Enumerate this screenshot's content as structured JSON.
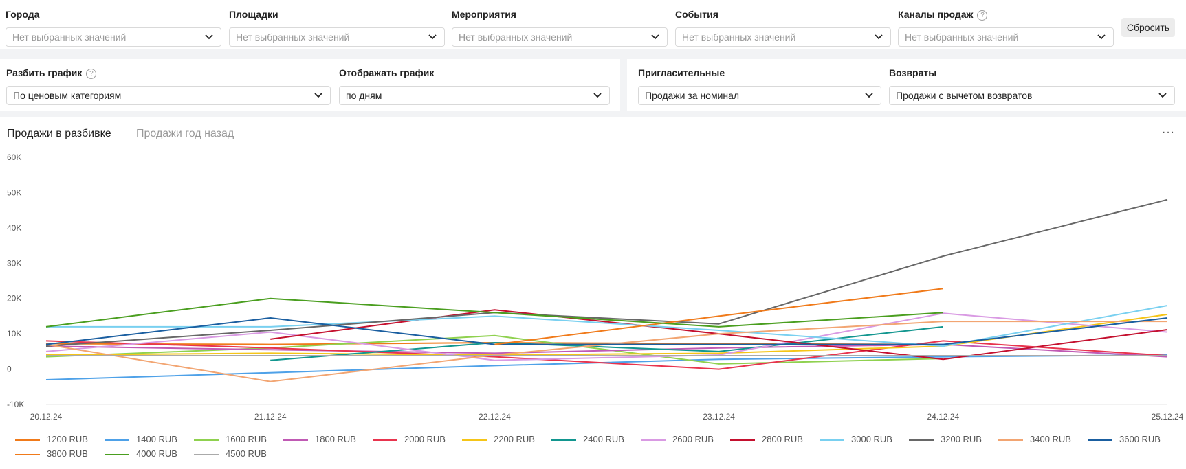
{
  "filters": {
    "cities": {
      "label": "Города",
      "placeholder": "Нет выбранных значений"
    },
    "venues": {
      "label": "Площадки",
      "placeholder": "Нет выбранных значений"
    },
    "events_group": {
      "label": "Мероприятия",
      "placeholder": "Нет выбранных значений"
    },
    "events": {
      "label": "События",
      "placeholder": "Нет выбранных значений"
    },
    "channels": {
      "label": "Каналы продаж",
      "placeholder": "Нет выбранных значений"
    },
    "reset_label": "Сбросить"
  },
  "options": {
    "split": {
      "label": "Разбить график",
      "value": "По ценовым категориям"
    },
    "display": {
      "label": "Отображать график",
      "value": "по дням"
    },
    "invitations": {
      "label": "Пригласительные",
      "value": "Продажи за номинал"
    },
    "returns": {
      "label": "Возвраты",
      "value": "Продажи с вычетом возвратов"
    }
  },
  "tabs": {
    "active": "Продажи в разбивке",
    "inactive": "Продажи год назад",
    "more": "···"
  },
  "icons": {
    "help": "question-circle-icon",
    "chevron": "chevron-down-icon",
    "more": "more-horizontal-icon"
  },
  "chart_data": {
    "type": "line",
    "x": [
      "20.12.24",
      "21.12.24",
      "22.12.24",
      "23.12.24",
      "24.12.24",
      "25.12.24"
    ],
    "y_ticks": [
      "60K",
      "50K",
      "40K",
      "30K",
      "20K",
      "10K",
      "0",
      "-10K"
    ],
    "ylim": [
      -10000,
      60000
    ],
    "grid": false,
    "legend_position": "bottom",
    "series": [
      {
        "name": "1200 RUB",
        "color": "#f07a1a",
        "values": [
          7200,
          7000,
          7500,
          7200,
          7000,
          null
        ]
      },
      {
        "name": "1400 RUB",
        "color": "#4ea1e8",
        "values": [
          -3000,
          -1000,
          1000,
          2800,
          3500,
          4000
        ]
      },
      {
        "name": "1600 RUB",
        "color": "#8fd14f",
        "values": [
          3500,
          6000,
          9500,
          1500,
          3000,
          null
        ]
      },
      {
        "name": "1800 RUB",
        "color": "#c05ab4",
        "values": [
          6500,
          5500,
          4500,
          6000,
          7000,
          3500
        ]
      },
      {
        "name": "2000 RUB",
        "color": "#e8344e",
        "values": [
          8000,
          6000,
          3500,
          0,
          8000,
          3800
        ]
      },
      {
        "name": "2200 RUB",
        "color": "#f5c518",
        "values": [
          4000,
          4500,
          4000,
          4500,
          6500,
          15500
        ]
      },
      {
        "name": "2400 RUB",
        "color": "#12968f",
        "values": [
          null,
          2500,
          7500,
          5000,
          12000,
          null
        ]
      },
      {
        "name": "2600 RUB",
        "color": "#d99ae3",
        "values": [
          5000,
          10500,
          2500,
          4000,
          15800,
          10500
        ]
      },
      {
        "name": "2800 RUB",
        "color": "#c4102e",
        "values": [
          null,
          8500,
          16800,
          10000,
          2800,
          11200
        ]
      },
      {
        "name": "3000 RUB",
        "color": "#79d0f0",
        "values": [
          12000,
          12000,
          15000,
          11000,
          6500,
          18000
        ]
      },
      {
        "name": "3200 RUB",
        "color": "#676767",
        "values": [
          6500,
          11000,
          16000,
          12800,
          32000,
          48000
        ]
      },
      {
        "name": "3400 RUB",
        "color": "#f2a572",
        "values": [
          7000,
          -3500,
          4000,
          10000,
          13500,
          13500
        ]
      },
      {
        "name": "3600 RUB",
        "color": "#1a5ea0",
        "values": [
          7000,
          14500,
          7000,
          7000,
          7000,
          14500
        ]
      },
      {
        "name": "3800 RUB",
        "color": "#f07a1a",
        "values": [
          null,
          null,
          7000,
          15000,
          22800,
          null
        ]
      },
      {
        "name": "4000 RUB",
        "color": "#4a9e1f",
        "values": [
          12000,
          20000,
          16000,
          12000,
          16000,
          null
        ]
      },
      {
        "name": "4500 RUB",
        "color": "#aaaaaa",
        "values": [
          3800,
          3800,
          3800,
          3800,
          3800,
          3800
        ]
      }
    ]
  }
}
